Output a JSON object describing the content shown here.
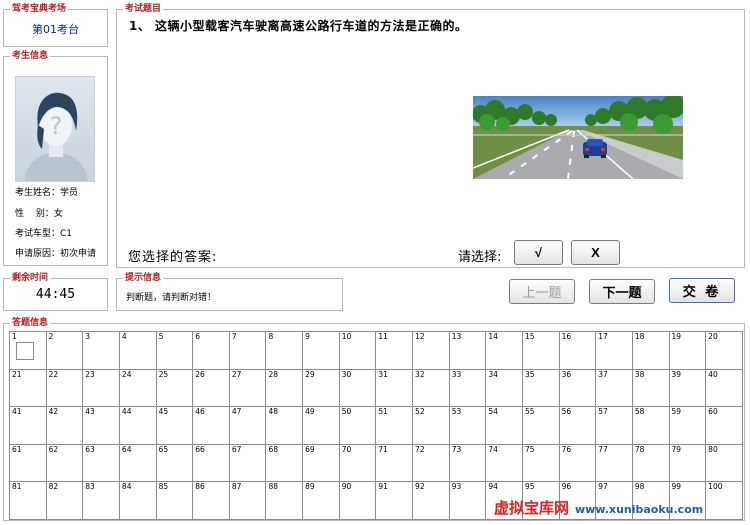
{
  "exam_site": {
    "legend": "驾考宝典考场",
    "value": "第01考台"
  },
  "candidate": {
    "legend": "考生信息",
    "name_row": "考生姓名：学员",
    "gender_row": "性　 别：女",
    "car_type_row": "考试车型：C1",
    "reason_row": "申请原因：初次申请"
  },
  "timer": {
    "legend": "剩余时间",
    "value": "44:45"
  },
  "question": {
    "legend": "考试题目",
    "text": "1、 这辆小型载客汽车驶离高速公路行车道的方法是正确的。",
    "answer_label": "您选择的答案:",
    "choose_label": "请选择:",
    "option_yes": "√",
    "option_no": "X"
  },
  "hint": {
    "legend": "提示信息",
    "value": "判断题，请判断对错！"
  },
  "nav": {
    "prev": "上一题",
    "next": "下一题",
    "submit": "交 卷"
  },
  "answer_sheet": {
    "legend": "答题信息",
    "columns": 20,
    "total": 100
  },
  "icons": {
    "question-mark-icon": "?"
  },
  "colors": {
    "legend_red": "#b22222",
    "site_blue": "#0a2a8a",
    "watermark_red": "#e02020",
    "watermark_blue": "#1f5fa8"
  },
  "watermark": {
    "brand": "虚拟宝库网",
    "site": "www.xunibaoku.com"
  }
}
